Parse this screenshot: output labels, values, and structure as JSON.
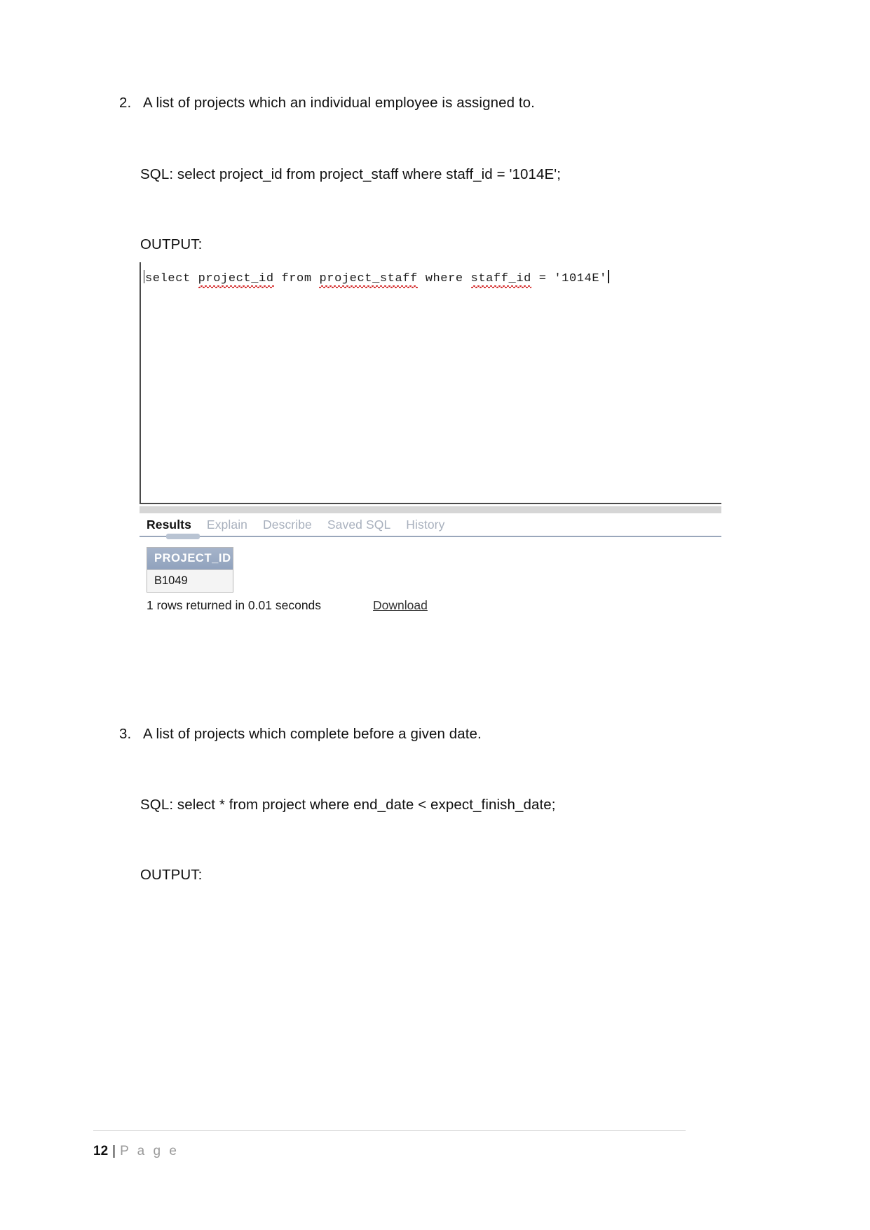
{
  "document": {
    "items": [
      {
        "number": "2.",
        "text": "A list of projects which an individual employee is assigned to.",
        "sql_label": "SQL: select project_id from project_staff where staff_id = '1014E';",
        "output_label": "OUTPUT:"
      },
      {
        "number": "3.",
        "text": "A list of projects which complete before a given date.",
        "sql_label": "SQL: select * from project where end_date < expect_finish_date;",
        "output_label": "OUTPUT:"
      }
    ],
    "footer": {
      "page_number": "12",
      "separator": "|",
      "page_word": "P a g e"
    }
  },
  "screenshot": {
    "editor": {
      "segments": [
        {
          "text": "select ",
          "misspelled": false
        },
        {
          "text": "project_id",
          "misspelled": true
        },
        {
          "text": " from ",
          "misspelled": false
        },
        {
          "text": "project_staff",
          "misspelled": true
        },
        {
          "text": " where ",
          "misspelled": false
        },
        {
          "text": "staff_id",
          "misspelled": true
        },
        {
          "text": " = '1014E'",
          "misspelled": false
        }
      ],
      "full_text": "select project_id from project_staff where staff_id = '1014E'"
    },
    "tabs": [
      {
        "label": "Results",
        "active": true
      },
      {
        "label": "Explain",
        "active": false
      },
      {
        "label": "Describe",
        "active": false
      },
      {
        "label": "Saved SQL",
        "active": false
      },
      {
        "label": "History",
        "active": false
      }
    ],
    "results_table": {
      "columns": [
        "PROJECT_ID"
      ],
      "rows": [
        [
          "B1049"
        ]
      ]
    },
    "status": {
      "rows_returned": "1 rows returned in 0.01 seconds",
      "download_label": "Download"
    },
    "colors": {
      "header_blue": "#9aaac4",
      "tab_underline": "#9aa7bb",
      "spellcheck_red": "#d42b2b",
      "muted_tab": "#a8b0bd"
    }
  }
}
